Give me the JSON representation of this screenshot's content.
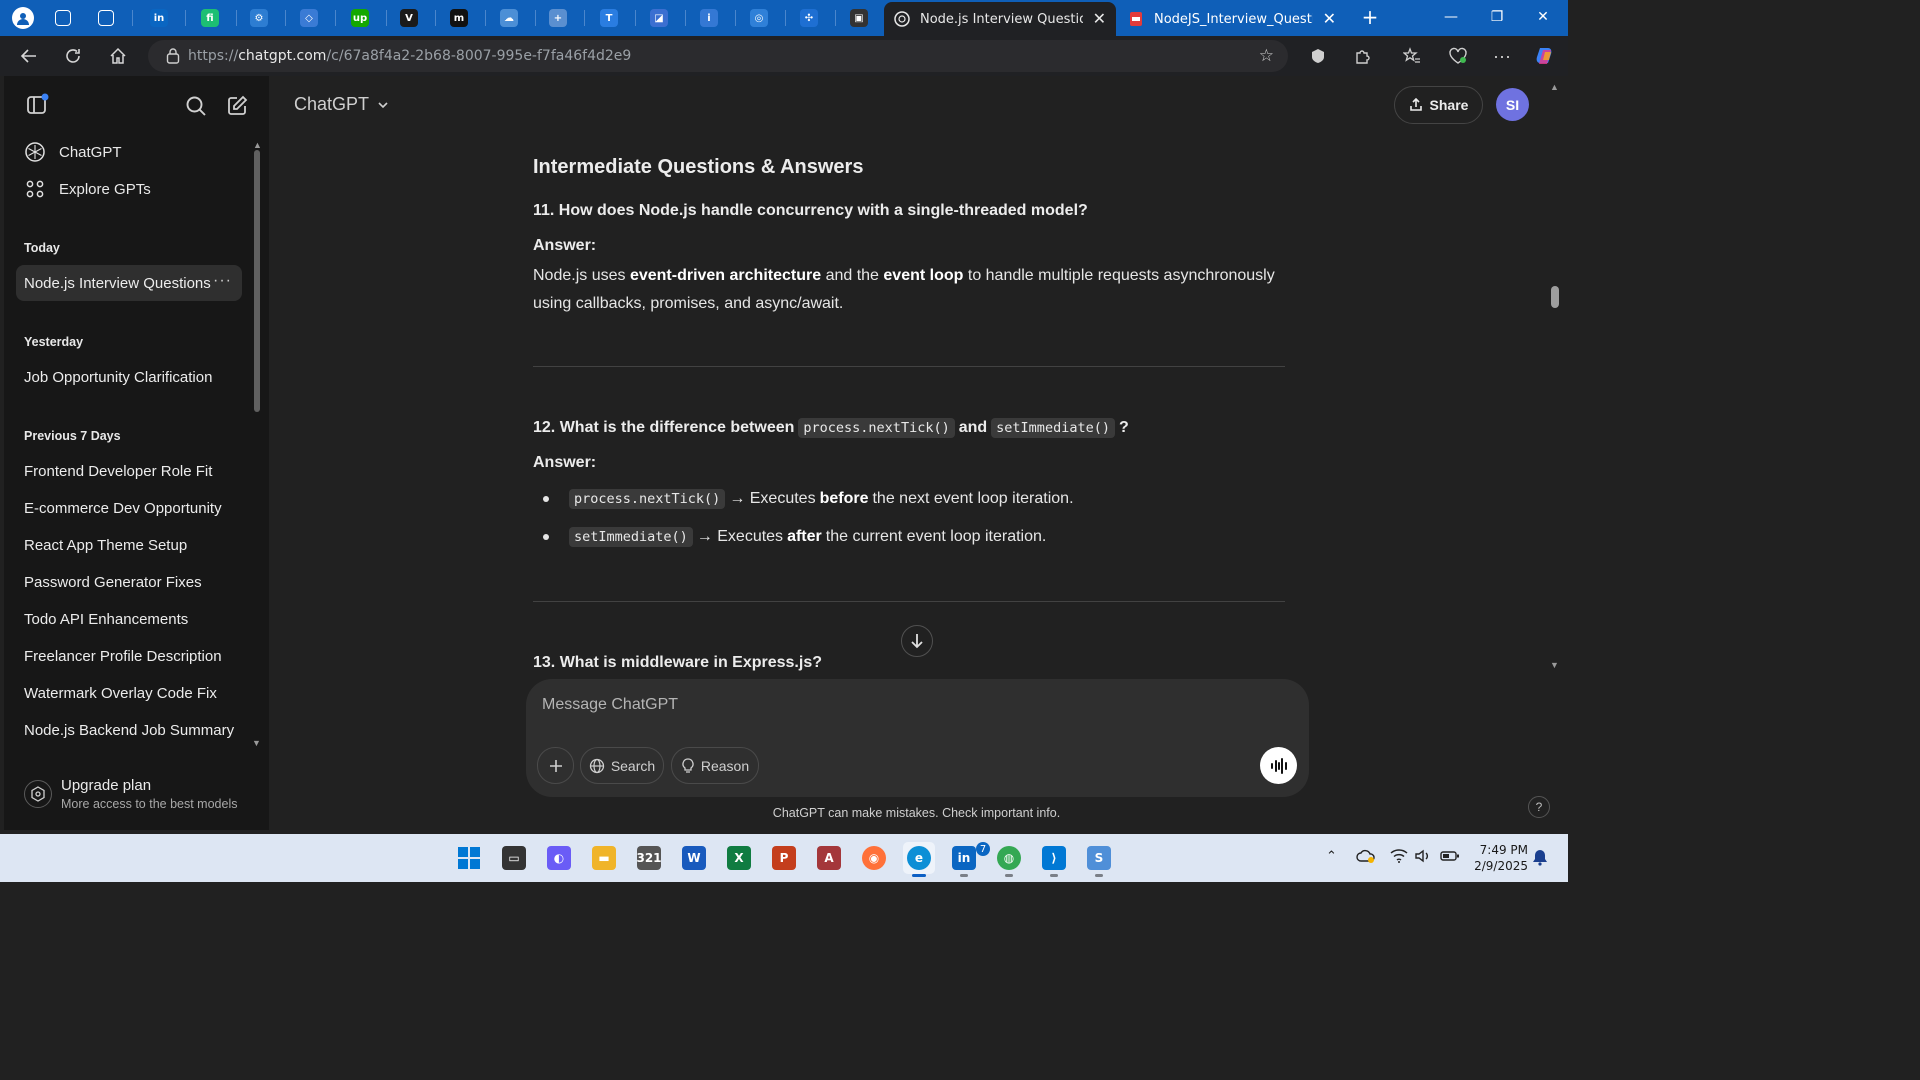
{
  "browser": {
    "pinned_tabs": [
      {
        "name": "copilot-tab",
        "glyph": "",
        "color": "#ffffff"
      },
      {
        "name": "workspaces-tab",
        "glyph": "⧉",
        "color": "#0f5fb8"
      },
      {
        "name": "split-tab",
        "glyph": "▭",
        "color": "#0f5fb8"
      },
      {
        "name": "linkedin-tab",
        "glyph": "in",
        "color": "#0a66c2"
      },
      {
        "name": "fiverr-tab",
        "glyph": "fi",
        "color": "#1dbf73"
      },
      {
        "name": "settings-tab",
        "glyph": "⚙",
        "color": "#2d7dd2"
      },
      {
        "name": "vector-tab",
        "glyph": "◇",
        "color": "#3a7bd5"
      },
      {
        "name": "upwork-tab",
        "glyph": "up",
        "color": "#14a800"
      },
      {
        "name": "vertex-tab",
        "glyph": "V",
        "color": "#1a1a1a"
      },
      {
        "name": "medium-tab",
        "glyph": "m",
        "color": "#111111"
      },
      {
        "name": "cloud-tab",
        "glyph": "☁",
        "color": "#4c8fd6"
      },
      {
        "name": "plus-tab",
        "glyph": "+",
        "color": "#5a8fd0"
      },
      {
        "name": "tp-tab",
        "glyph": "T",
        "color": "#2a7de1"
      },
      {
        "name": "shape-tab",
        "glyph": "◪",
        "color": "#3b6fd1"
      },
      {
        "name": "info-tab",
        "glyph": "i",
        "color": "#3478d4"
      },
      {
        "name": "circle-tab",
        "glyph": "◎",
        "color": "#2f80d8"
      },
      {
        "name": "nodes-tab",
        "glyph": "✣",
        "color": "#1e6fd2"
      },
      {
        "name": "dark-tab",
        "glyph": "▣",
        "color": "#333333"
      }
    ],
    "tabs": [
      {
        "title": "Node.js Interview Questions",
        "active": true
      },
      {
        "title": "NodeJS_Interview_Questions.pdf",
        "active": false
      }
    ],
    "url_prefix": "https://",
    "url_host": "chatgpt.com",
    "url_path": "/c/67a8f4a2-2b68-8007-995e-f7fa46f4d2e9"
  },
  "sidebar": {
    "top_items": [
      {
        "label": "ChatGPT",
        "icon": "openai-icon"
      },
      {
        "label": "Explore GPTs",
        "icon": "grid-icon"
      }
    ],
    "groups": [
      {
        "label": "Today",
        "items": [
          {
            "label": "Node.js Interview Questions",
            "selected": true
          }
        ]
      },
      {
        "label": "Yesterday",
        "items": [
          {
            "label": "Job Opportunity Clarification"
          }
        ]
      },
      {
        "label": "Previous 7 Days",
        "items": [
          {
            "label": "Frontend Developer Role Fit"
          },
          {
            "label": "E-commerce Dev Opportunity"
          },
          {
            "label": "React App Theme Setup"
          },
          {
            "label": "Password Generator Fixes"
          },
          {
            "label": "Todo API Enhancements"
          },
          {
            "label": "Freelancer Profile Description"
          },
          {
            "label": "Watermark Overlay Code Fix"
          },
          {
            "label": "Node.js Backend Job Summary"
          }
        ]
      }
    ],
    "upgrade": {
      "title": "Upgrade plan",
      "subtitle": "More access to the best models"
    }
  },
  "header": {
    "model": "ChatGPT",
    "share": "Share",
    "avatar": "SI"
  },
  "content": {
    "section_title": "Intermediate Questions & Answers",
    "q11": {
      "title": "11. How does Node.js handle concurrency with a single-threaded model?",
      "answer_label": "Answer:",
      "a_part1": "Node.js uses ",
      "a_bold1": "event-driven architecture",
      "a_part2": " and the ",
      "a_bold2": "event loop",
      "a_part3": " to handle multiple requests asynchronously using callbacks, promises, and async/await."
    },
    "q12": {
      "title_prefix": "12. What is the difference between",
      "code1": "process.nextTick()",
      "and": "and",
      "code2": "setImmediate()",
      "title_suffix": "?",
      "answer_label": "Answer:",
      "b1_code": "process.nextTick()",
      "b1_text1": " → Executes ",
      "b1_bold": "before",
      "b1_text2": " the next event loop iteration.",
      "b2_code": "setImmediate()",
      "b2_text1": " → Executes ",
      "b2_bold": "after",
      "b2_text2": " the current event loop iteration."
    },
    "q13": {
      "title": "13. What is middleware in Express.js?"
    }
  },
  "composer": {
    "placeholder": "Message ChatGPT",
    "search": "Search",
    "reason": "Reason"
  },
  "disclaimer": "ChatGPT can make mistakes. Check important info.",
  "taskbar": {
    "apps": [
      {
        "name": "start-button",
        "glyph": "",
        "color": "#0078d4"
      },
      {
        "name": "task-view",
        "glyph": "▭",
        "color": "#333333"
      },
      {
        "name": "copilot-app",
        "glyph": "◐",
        "color": "#6a5cf6"
      },
      {
        "name": "file-explorer",
        "glyph": "▬",
        "color": "#f0b429"
      },
      {
        "name": "calendar-app",
        "glyph": "321",
        "color": "#555555"
      },
      {
        "name": "word-app",
        "glyph": "W",
        "color": "#185abd"
      },
      {
        "name": "excel-app",
        "glyph": "X",
        "color": "#107c41"
      },
      {
        "name": "powerpoint-app",
        "glyph": "P",
        "color": "#c43e1c"
      },
      {
        "name": "access-app",
        "glyph": "A",
        "color": "#a4373a"
      },
      {
        "name": "firefox-app",
        "glyph": "◉",
        "color": "#ff7139"
      },
      {
        "name": "edge-app",
        "glyph": "e",
        "color": "#0c8fd6"
      },
      {
        "name": "linkedin-app",
        "glyph": "in",
        "color": "#0a66c2"
      },
      {
        "name": "chrome-app",
        "glyph": "◍",
        "color": "#34a853"
      },
      {
        "name": "vscode-app",
        "glyph": "⟩",
        "color": "#0078d4"
      },
      {
        "name": "s-app",
        "glyph": "S",
        "color": "#4f8fd8"
      }
    ],
    "linkedin_badge": "7",
    "time": "7:49 PM",
    "date": "2/9/2025"
  }
}
